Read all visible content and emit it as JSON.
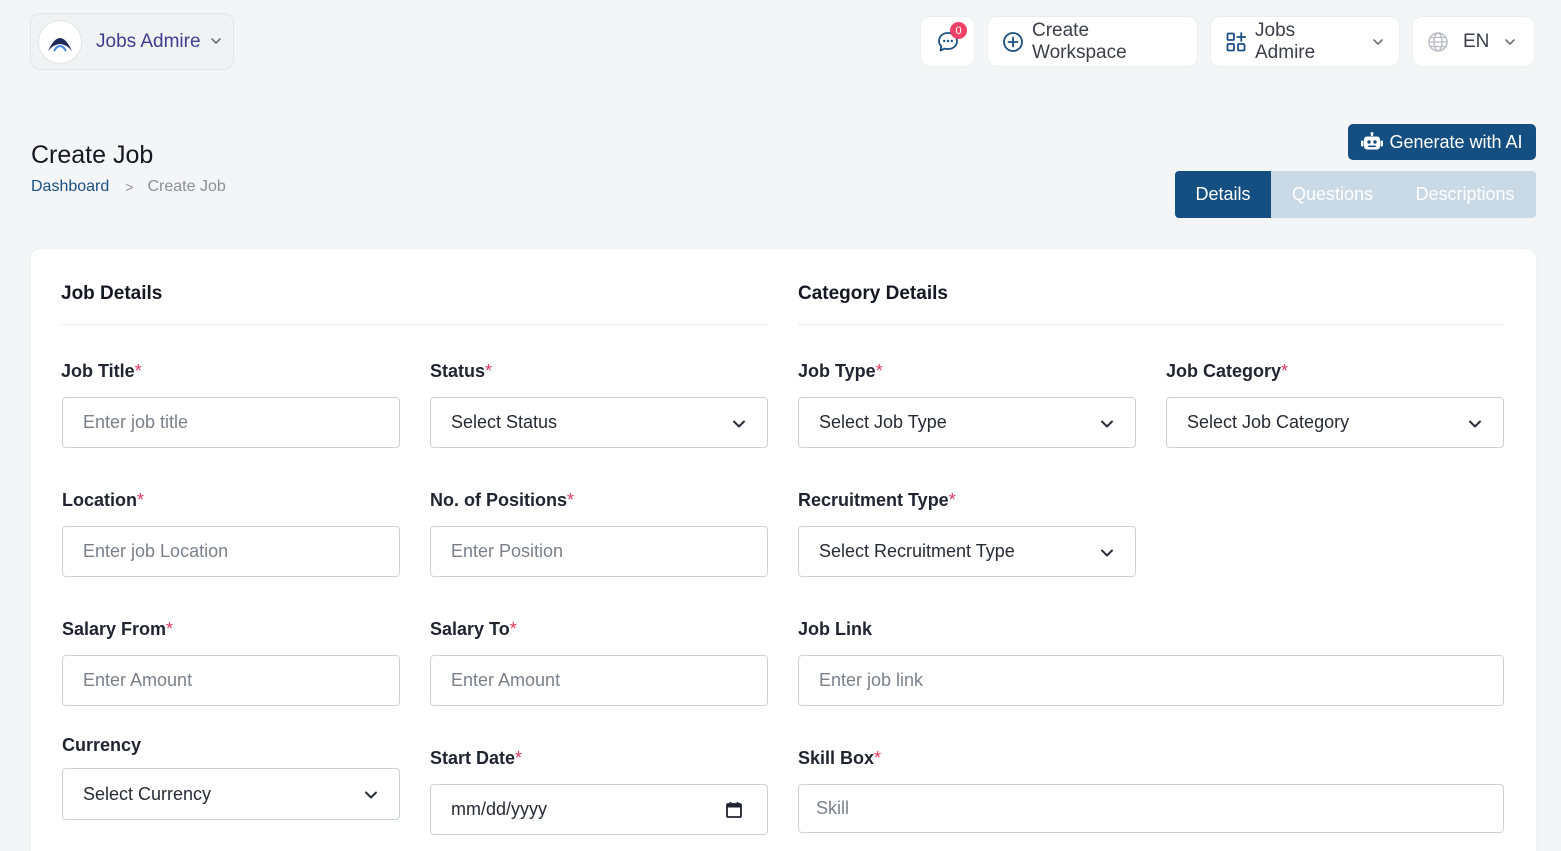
{
  "topbar": {
    "org_name": "Jobs Admire",
    "chat_count": "0",
    "create_workspace": "Create Workspace",
    "workspace_name": "Jobs Admire",
    "language": "EN"
  },
  "page": {
    "title": "Create Job",
    "breadcrumb": {
      "home": "Dashboard",
      "separator": ">",
      "current": "Create Job"
    },
    "generate_ai": "Generate with AI",
    "tabs": [
      "Details",
      "Questions",
      "Descriptions"
    ],
    "active_tab": "Details"
  },
  "sections": {
    "job": "Job Details",
    "category": "Category Details"
  },
  "required_mark": "*",
  "fields": {
    "job_title": {
      "label": "Job Title",
      "placeholder": "Enter job title"
    },
    "status": {
      "label": "Status",
      "value": "Select Status"
    },
    "job_type": {
      "label": "Job Type",
      "value": "Select Job Type"
    },
    "job_category": {
      "label": "Job Category",
      "value": "Select Job Category"
    },
    "location": {
      "label": "Location",
      "placeholder": "Enter job Location"
    },
    "positions": {
      "label": "No. of Positions",
      "placeholder": "Enter Position"
    },
    "recruitment_type": {
      "label": "Recruitment Type",
      "value": "Select Recruitment Type"
    },
    "salary_from": {
      "label": "Salary From",
      "placeholder": "Enter Amount"
    },
    "salary_to": {
      "label": "Salary To",
      "placeholder": "Enter Amount"
    },
    "job_link": {
      "label": "Job Link",
      "placeholder": "Enter job link"
    },
    "currency": {
      "label": "Currency",
      "value": "Select Currency"
    },
    "start_date": {
      "label": "Start Date",
      "placeholder": "mm/dd/yyyy"
    },
    "skill_box": {
      "label": "Skill Box",
      "placeholder": "Skill"
    }
  },
  "colors": {
    "primary": "#154f82",
    "tab_inactive_bg": "#c9d9e5",
    "required": "#e23b61",
    "badge": "#ef4266",
    "org_text": "#3f3d8f"
  }
}
